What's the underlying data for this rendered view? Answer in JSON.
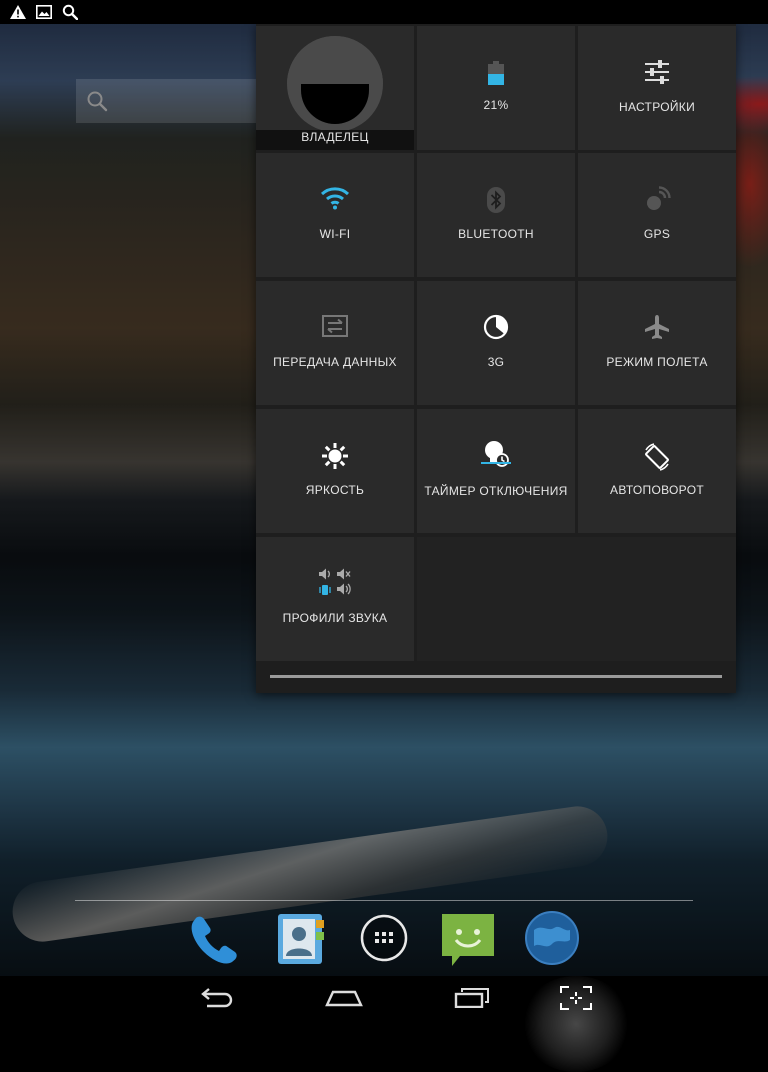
{
  "status_bar": {
    "icons": [
      "warning-icon",
      "image-icon",
      "search-icon"
    ]
  },
  "quick_settings": {
    "owner": {
      "label": "ВЛАДЕЛЕЦ"
    },
    "battery": {
      "label": "21%",
      "level": 0.21
    },
    "settings": {
      "label": "НАСТРОЙКИ"
    },
    "wifi": {
      "label": "WI-FI"
    },
    "bluetooth": {
      "label": "BLUETOOTH"
    },
    "gps": {
      "label": "GPS"
    },
    "data_transfer": {
      "label": "ПЕРЕДАЧА ДАННЫХ"
    },
    "network": {
      "label": "3G"
    },
    "airplane": {
      "label": "РЕЖИМ ПОЛЕТА"
    },
    "brightness": {
      "label": "ЯРКОСТЬ"
    },
    "sleep_timer": {
      "label": "ТАЙМЕР ОТКЛЮЧЕНИЯ"
    },
    "auto_rotate": {
      "label": "АВТОПОВОРОТ"
    },
    "sound_profiles": {
      "label": "ПРОФИЛИ ЗВУКА"
    }
  },
  "colors": {
    "accent": "#33b5e5",
    "tile_bg": "#2a2a2a",
    "panel_bg": "#1e1e1e",
    "label": "#e6e6e6"
  },
  "dock": {
    "apps": [
      "phone-icon",
      "contacts-icon",
      "all-apps-icon",
      "messaging-icon",
      "browser-icon"
    ]
  },
  "nav_bar": {
    "buttons": [
      "back-icon",
      "home-icon",
      "recents-icon",
      "screenshot-icon"
    ]
  }
}
